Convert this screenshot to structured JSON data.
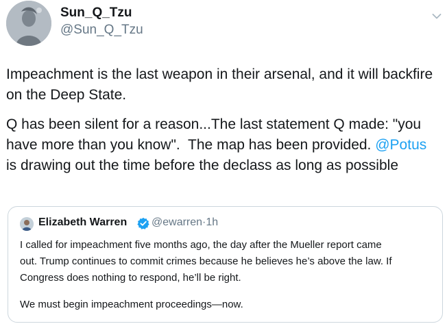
{
  "tweet": {
    "author": {
      "display_name": "Sun_Q_Tzu",
      "handle": "@Sun_Q_Tzu"
    },
    "paragraph1": {
      "line1": "Impeachment is the last weapon in their arsenal, and it will backfire",
      "line2": "on the Deep State."
    },
    "paragraph2": {
      "line1": "Q has been silent for a reason...The last statement Q made: \"you",
      "line2": "have more than you know\".  The map has been provided. ",
      "mention": "@Potus",
      "line3": "is drawing out the time before the declass as long as possible"
    }
  },
  "quoted_tweet": {
    "author_name": "Elizabeth Warren",
    "handle": "@ewarren",
    "separator": "·",
    "time": "1h",
    "paragraph1": {
      "line1": "I called for impeachment five months ago, the day after the Mueller report came",
      "line2": "out. Trump continues to commit crimes because he believes he’s above the law. If",
      "line3": "Congress does nothing to respond, he’ll be right."
    },
    "paragraph2": "We must begin impeachment proceedings—now."
  },
  "icons": {
    "menu": "chevron-down-icon",
    "verified": "verified-badge-icon"
  },
  "colors": {
    "link": "#1da1f2",
    "secondary_text": "#657786",
    "primary_text": "#14171a",
    "border": "#ccd6dd",
    "verified": "#1da1f2"
  }
}
